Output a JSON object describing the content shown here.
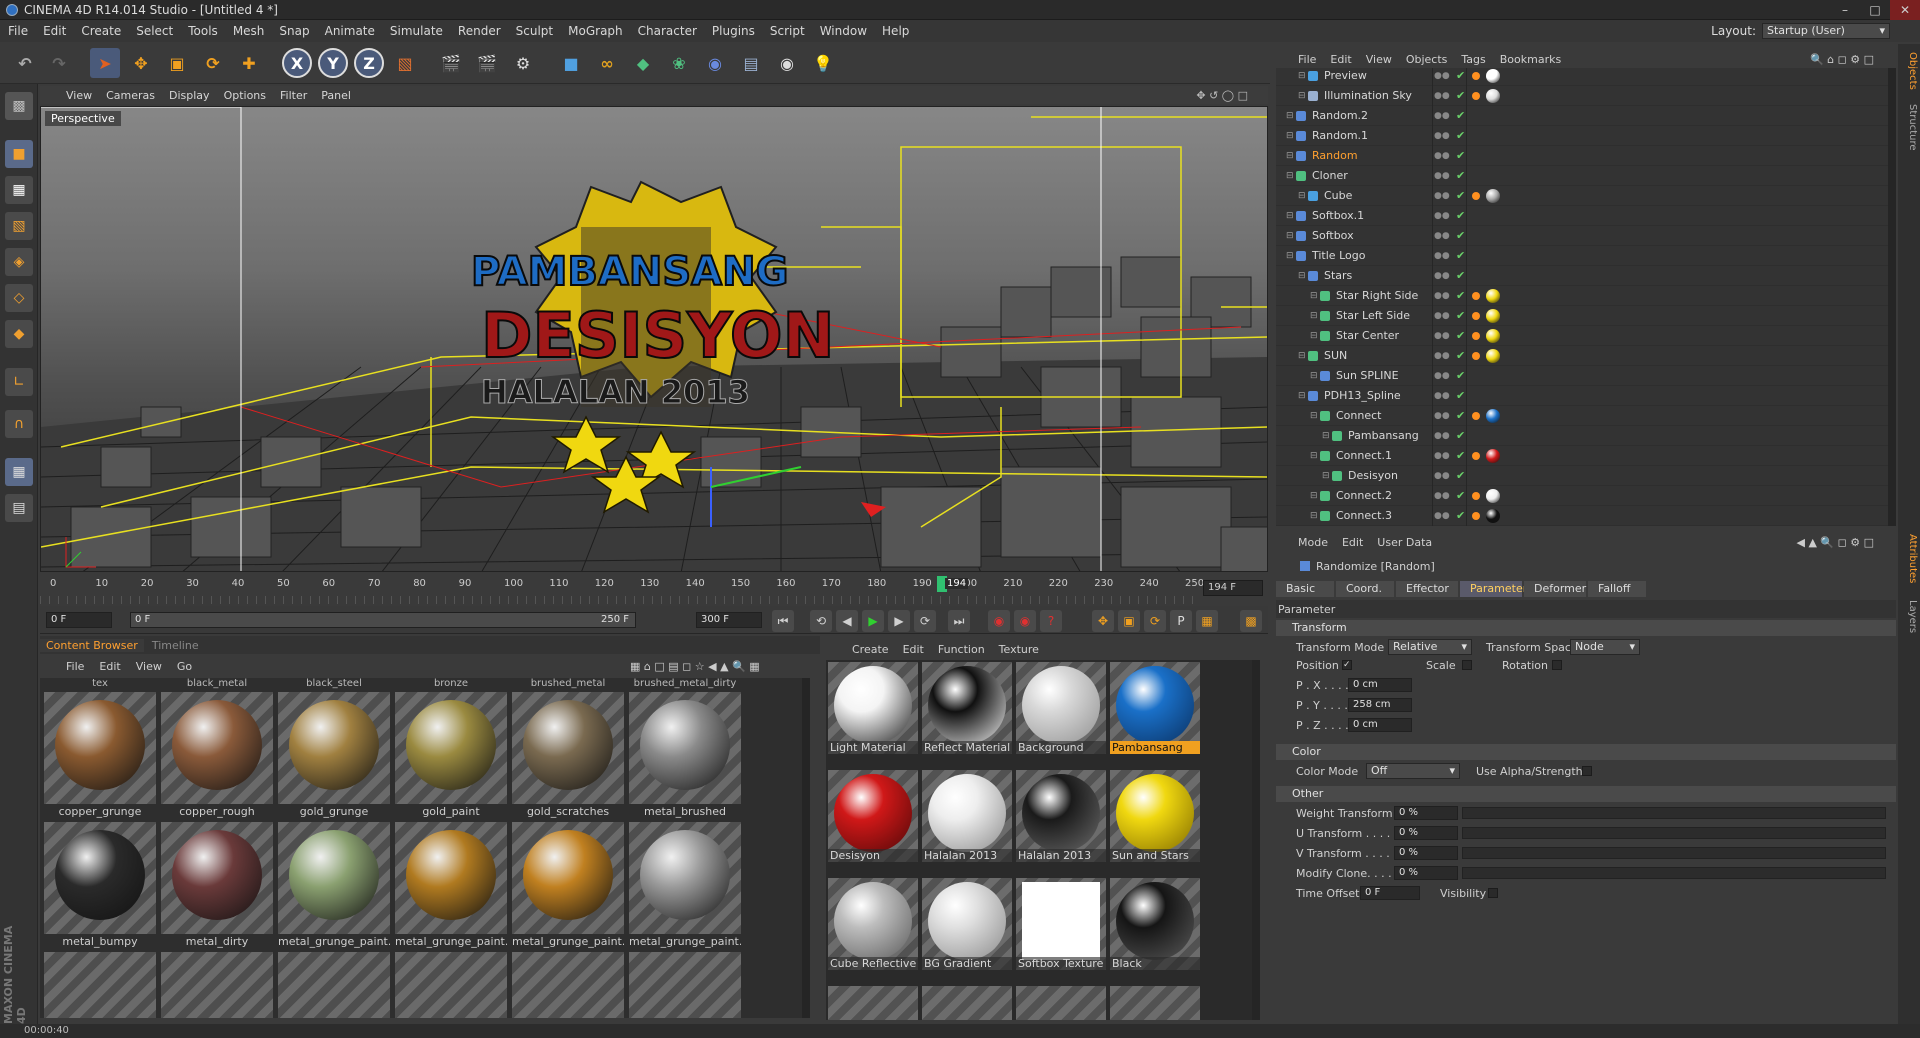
{
  "window": {
    "title": "CINEMA 4D R14.014 Studio - [Untitled 4 *]"
  },
  "menu": [
    "File",
    "Edit",
    "Create",
    "Select",
    "Tools",
    "Mesh",
    "Snap",
    "Animate",
    "Simulate",
    "Render",
    "Sculpt",
    "MoGraph",
    "Character",
    "Plugins",
    "Script",
    "Window",
    "Help"
  ],
  "layout": {
    "label": "Layout:",
    "value": "Startup (User)"
  },
  "viewport": {
    "menu": [
      "View",
      "Cameras",
      "Display",
      "Options",
      "Filter",
      "Panel"
    ],
    "label": "Perspective",
    "logo_line1": "PAMBANSANG",
    "logo_line2": "DESISYON",
    "logo_line3": "HALALAN 2013"
  },
  "timeline": {
    "ticks": [
      "0",
      "10",
      "20",
      "30",
      "40",
      "50",
      "60",
      "70",
      "80",
      "90",
      "100",
      "110",
      "120",
      "130",
      "140",
      "150",
      "160",
      "170",
      "180",
      "190",
      "200",
      "210",
      "220",
      "230",
      "240",
      "250"
    ],
    "current_frame": "194",
    "current_frame_field": "194 F",
    "start_field": "0 F",
    "range_start": "0 F",
    "range_end": "250 F",
    "end_field": "300 F"
  },
  "content_browser": {
    "tabs": [
      "Content Browser",
      "Timeline"
    ],
    "menu": [
      "File",
      "Edit",
      "View",
      "Go"
    ],
    "top_labels": [
      "tex",
      "black_metal",
      "black_steel",
      "bronze",
      "brushed_metal",
      "brushed_metal_dirty"
    ],
    "row1": [
      {
        "name": "copper_grunge",
        "color": "#8a5a30"
      },
      {
        "name": "copper_rough",
        "color": "#8a5a3a"
      },
      {
        "name": "gold_grunge",
        "color": "#a08040"
      },
      {
        "name": "gold_paint",
        "color": "#9a8a40"
      },
      {
        "name": "gold_scratches",
        "color": "#7a6a50"
      },
      {
        "name": "metal_brushed",
        "color": "#8a8a8a"
      }
    ],
    "row2": [
      {
        "name": "metal_bumpy",
        "color": "#2a2a2a"
      },
      {
        "name": "metal_dirty",
        "color": "#6a3a3a"
      },
      {
        "name": "metal_grunge_paint..",
        "color": "#8aa070"
      },
      {
        "name": "metal_grunge_paint..",
        "color": "#b07a20"
      },
      {
        "name": "metal_grunge_paint..",
        "color": "#c08020"
      },
      {
        "name": "metal_grunge_paint..",
        "color": "#9a9a9a"
      }
    ]
  },
  "materials": {
    "menu": [
      "Create",
      "Edit",
      "Function",
      "Texture"
    ],
    "items": [
      {
        "name": "Light Material",
        "color": "#f4f4f4",
        "dark": "#202020"
      },
      {
        "name": "Reflect Material",
        "color": "#101010",
        "dark": "#f0f0f0"
      },
      {
        "name": "Background",
        "color": "#d8d8d8",
        "dark": "#909090"
      },
      {
        "name": "Pambansang",
        "color": "#1a70c8",
        "dark": "#0a3060",
        "selected": true
      },
      {
        "name": "Desisyon",
        "color": "#d01818",
        "dark": "#500808"
      },
      {
        "name": "Halalan 2013",
        "color": "#eeeeee",
        "dark": "#8a8a8a"
      },
      {
        "name": "Halalan 2013",
        "color": "#1a1a1a",
        "dark": "#6a6a6a"
      },
      {
        "name": "Sun and Stars",
        "color": "#f0d810",
        "dark": "#806a00"
      },
      {
        "name": "Cube Reflective",
        "color": "#bdbdbd",
        "dark": "#5a5a5a"
      },
      {
        "name": "BG Gradient",
        "color": "#e0e0e0",
        "dark": "#8a8a8a"
      },
      {
        "name": "Softbox Texture",
        "color": "#ffffff",
        "dark": "#ffffff"
      },
      {
        "name": "Black",
        "color": "#151515",
        "dark": "#5a5a5a"
      }
    ]
  },
  "objects": {
    "menu": [
      "File",
      "Edit",
      "View",
      "Objects",
      "Tags",
      "Bookmarks"
    ],
    "rows": [
      {
        "name": "Preview",
        "indent": 2,
        "icon": "#4aa0e0"
      },
      {
        "name": "Illumination Sky",
        "indent": 2,
        "icon": "#9ab0d0"
      },
      {
        "name": "Random.2",
        "indent": 1,
        "icon": "#5a8ad8"
      },
      {
        "name": "Random.1",
        "indent": 1,
        "icon": "#5a8ad8"
      },
      {
        "name": "Random",
        "indent": 1,
        "icon": "#5a8ad8",
        "selected": true
      },
      {
        "name": "Cloner",
        "indent": 1,
        "icon": "#50c080"
      },
      {
        "name": "Cube",
        "indent": 2,
        "icon": "#4aa0e0"
      },
      {
        "name": "Softbox.1",
        "indent": 1,
        "icon": "#5a8ad8"
      },
      {
        "name": "Softbox",
        "indent": 1,
        "icon": "#5a8ad8"
      },
      {
        "name": "Title Logo",
        "indent": 1,
        "icon": "#5a8ad8"
      },
      {
        "name": "Stars",
        "indent": 2,
        "icon": "#5a8ad8"
      },
      {
        "name": "Star Right Side",
        "indent": 3,
        "icon": "#50c080"
      },
      {
        "name": "Star Left Side",
        "indent": 3,
        "icon": "#50c080"
      },
      {
        "name": "Star Center",
        "indent": 3,
        "icon": "#50c080"
      },
      {
        "name": "SUN",
        "indent": 2,
        "icon": "#50c080"
      },
      {
        "name": "Sun SPLINE",
        "indent": 3,
        "icon": "#5a8ad8"
      },
      {
        "name": "PDH13_Spline",
        "indent": 2,
        "icon": "#5a8ad8"
      },
      {
        "name": "Connect",
        "indent": 3,
        "icon": "#50c080"
      },
      {
        "name": "Pambansang",
        "indent": 4,
        "icon": "#50c080"
      },
      {
        "name": "Connect.1",
        "indent": 3,
        "icon": "#50c080"
      },
      {
        "name": "Desisyon",
        "indent": 4,
        "icon": "#50c080"
      },
      {
        "name": "Connect.2",
        "indent": 3,
        "icon": "#50c080"
      },
      {
        "name": "Connect.3",
        "indent": 3,
        "icon": "#50c080"
      }
    ]
  },
  "attributes": {
    "menu": [
      "Mode",
      "Edit",
      "User Data"
    ],
    "title": "Randomize [Random]",
    "tabs": [
      "Basic",
      "Coord.",
      "Effector",
      "Parameter",
      "Deformer",
      "Falloff"
    ],
    "active_tab": "Parameter",
    "section_parameter": "Parameter",
    "section_transform": "Transform",
    "transform_mode_label": "Transform Mode",
    "transform_mode": "Relative",
    "transform_space_label": "Transform Space",
    "transform_space": "Node",
    "position_label": "Position",
    "scale_label": "Scale",
    "rotation_label": "Rotation",
    "px_label": "P . X . . . .",
    "px": "0 cm",
    "py_label": "P . Y . . . .",
    "py": "258 cm",
    "pz_label": "P . Z . . . .",
    "pz": "0 cm",
    "section_color": "Color",
    "color_mode_label": "Color Mode",
    "color_mode": "Off",
    "use_alpha_label": "Use Alpha/Strength",
    "section_other": "Other",
    "weight_label": "Weight Transform",
    "weight": "0 %",
    "u_label": "U Transform . . . . .",
    "u": "0 %",
    "v_label": "V Transform . . . . .",
    "v": "0 %",
    "modify_label": "Modify Clone. . . . .",
    "modify": "0 %",
    "time_label": "Time Offset",
    "time": "0 F",
    "visibility_label": "Visibility"
  },
  "side_tabs": [
    "Objects",
    "Structure",
    "Attributes",
    "Layers"
  ],
  "status": {
    "time": "00:00:40"
  },
  "brand": "MAXON CINEMA 4D"
}
